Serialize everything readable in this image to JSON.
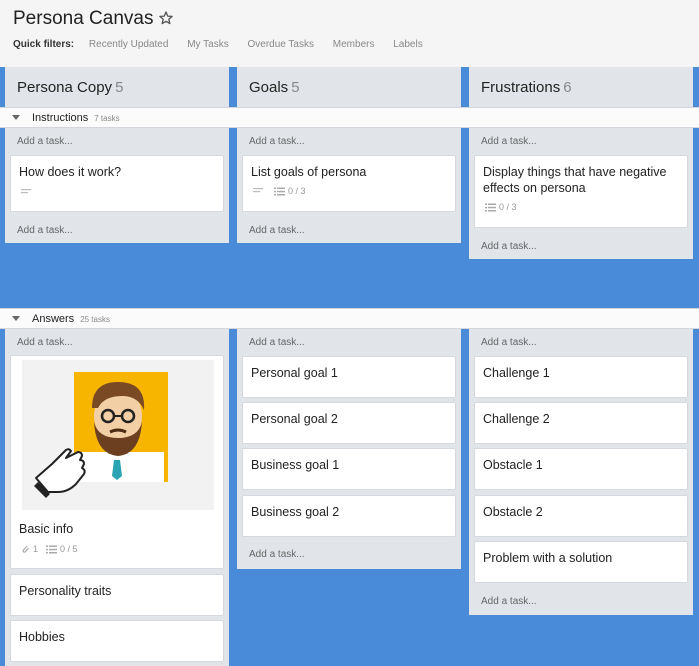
{
  "board": {
    "title": "Persona Canvas",
    "star_icon": "star-icon",
    "quick_filters_label": "Quick filters:",
    "filters": [
      "Recently Updated",
      "My Tasks",
      "Overdue Tasks",
      "Members",
      "Labels"
    ]
  },
  "columns": [
    {
      "name": "Persona Copy",
      "count": "5"
    },
    {
      "name": "Goals",
      "count": "5"
    },
    {
      "name": "Frustrations",
      "count": "6"
    }
  ],
  "add_task_label": "Add a task...",
  "lanes": [
    {
      "name": "Instructions",
      "count": "7 tasks",
      "cards": {
        "c0": [
          {
            "title": "How does it work?",
            "has_description": true
          }
        ],
        "c1": [
          {
            "title": "List goals of persona",
            "has_description": true,
            "checklist": "0 / 3"
          }
        ],
        "c2": [
          {
            "title": "Display things that have negative effects on persona",
            "checklist": "0 / 3"
          }
        ]
      }
    },
    {
      "name": "Answers",
      "count": "25 tasks",
      "cards": {
        "c0": [
          {
            "title": "Basic info",
            "attachments": "1",
            "checklist": "0 / 5",
            "cover": "persona-avatar-illustration"
          },
          {
            "title": "Personality traits"
          },
          {
            "title": "Hobbies"
          }
        ],
        "c1": [
          {
            "title": "Personal goal 1"
          },
          {
            "title": "Personal goal 2"
          },
          {
            "title": "Business goal 1"
          },
          {
            "title": "Business goal 2"
          }
        ],
        "c2": [
          {
            "title": "Challenge 1"
          },
          {
            "title": "Challenge 2"
          },
          {
            "title": "Obstacle 1"
          },
          {
            "title": "Obstacle 2"
          },
          {
            "title": "Problem with a solution"
          }
        ]
      }
    }
  ],
  "colors": {
    "board_bg": "#4a8bd9",
    "column_bg": "#e1e5e9",
    "card_bg": "#ffffff",
    "avatar_bg": "#f7b500"
  }
}
